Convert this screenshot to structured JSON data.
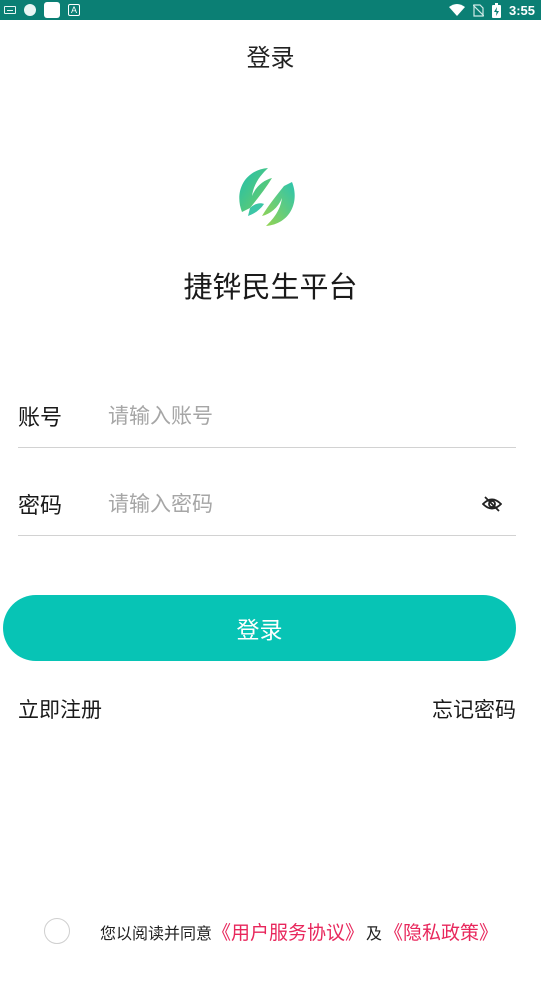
{
  "status_bar": {
    "time": "3:55",
    "icons": [
      "keyboard-icon",
      "vpn-icon",
      "app-notification-icon",
      "a-icon",
      "wifi-icon",
      "no-sim-icon",
      "battery-charging-icon"
    ],
    "background": "#0b7f74"
  },
  "header": {
    "title": "登录"
  },
  "app": {
    "name": "捷铧民生平台",
    "logo_colors": [
      "#27c3b1",
      "#8fd14f"
    ]
  },
  "form": {
    "account": {
      "label": "账号",
      "placeholder": "请输入账号",
      "value": ""
    },
    "password": {
      "label": "密码",
      "placeholder": "请输入密码",
      "value": "",
      "toggle_icon": "eye-off-icon"
    }
  },
  "login_button": {
    "label": "登录",
    "color": "#07c4b5"
  },
  "links": {
    "register": "立即注册",
    "forgot": "忘记密码"
  },
  "agreement": {
    "prefix": "您以阅读并同意",
    "user_agreement": "《用户服务协议》",
    "and": "及",
    "privacy_policy": "《隐私政策》",
    "link_color": "#e8275c",
    "checked": false
  }
}
